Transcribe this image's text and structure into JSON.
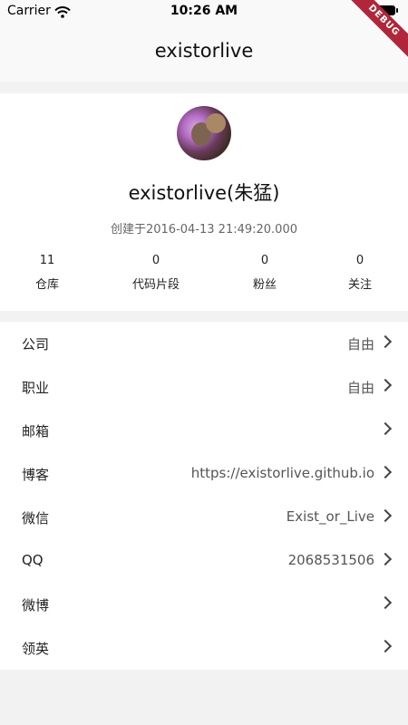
{
  "status": {
    "carrier": "Carrier",
    "time": "10:26 AM"
  },
  "debug_banner": "DEBUG",
  "nav": {
    "title": "existorlive"
  },
  "profile": {
    "display_name": "existorlive(朱猛)",
    "created_at": "创建于2016-04-13 21:49:20.000"
  },
  "stats": [
    {
      "count": "11",
      "label": "仓库"
    },
    {
      "count": "0",
      "label": "代码片段"
    },
    {
      "count": "0",
      "label": "粉丝"
    },
    {
      "count": "0",
      "label": "关注"
    }
  ],
  "info": [
    {
      "label": "公司",
      "value": "自由"
    },
    {
      "label": "职业",
      "value": "自由"
    },
    {
      "label": "邮箱",
      "value": ""
    },
    {
      "label": "博客",
      "value": "https://existorlive.github.io"
    },
    {
      "label": "微信",
      "value": "Exist_or_Live"
    },
    {
      "label": "QQ",
      "value": "2068531506"
    },
    {
      "label": "微博",
      "value": ""
    },
    {
      "label": "领英",
      "value": ""
    }
  ]
}
